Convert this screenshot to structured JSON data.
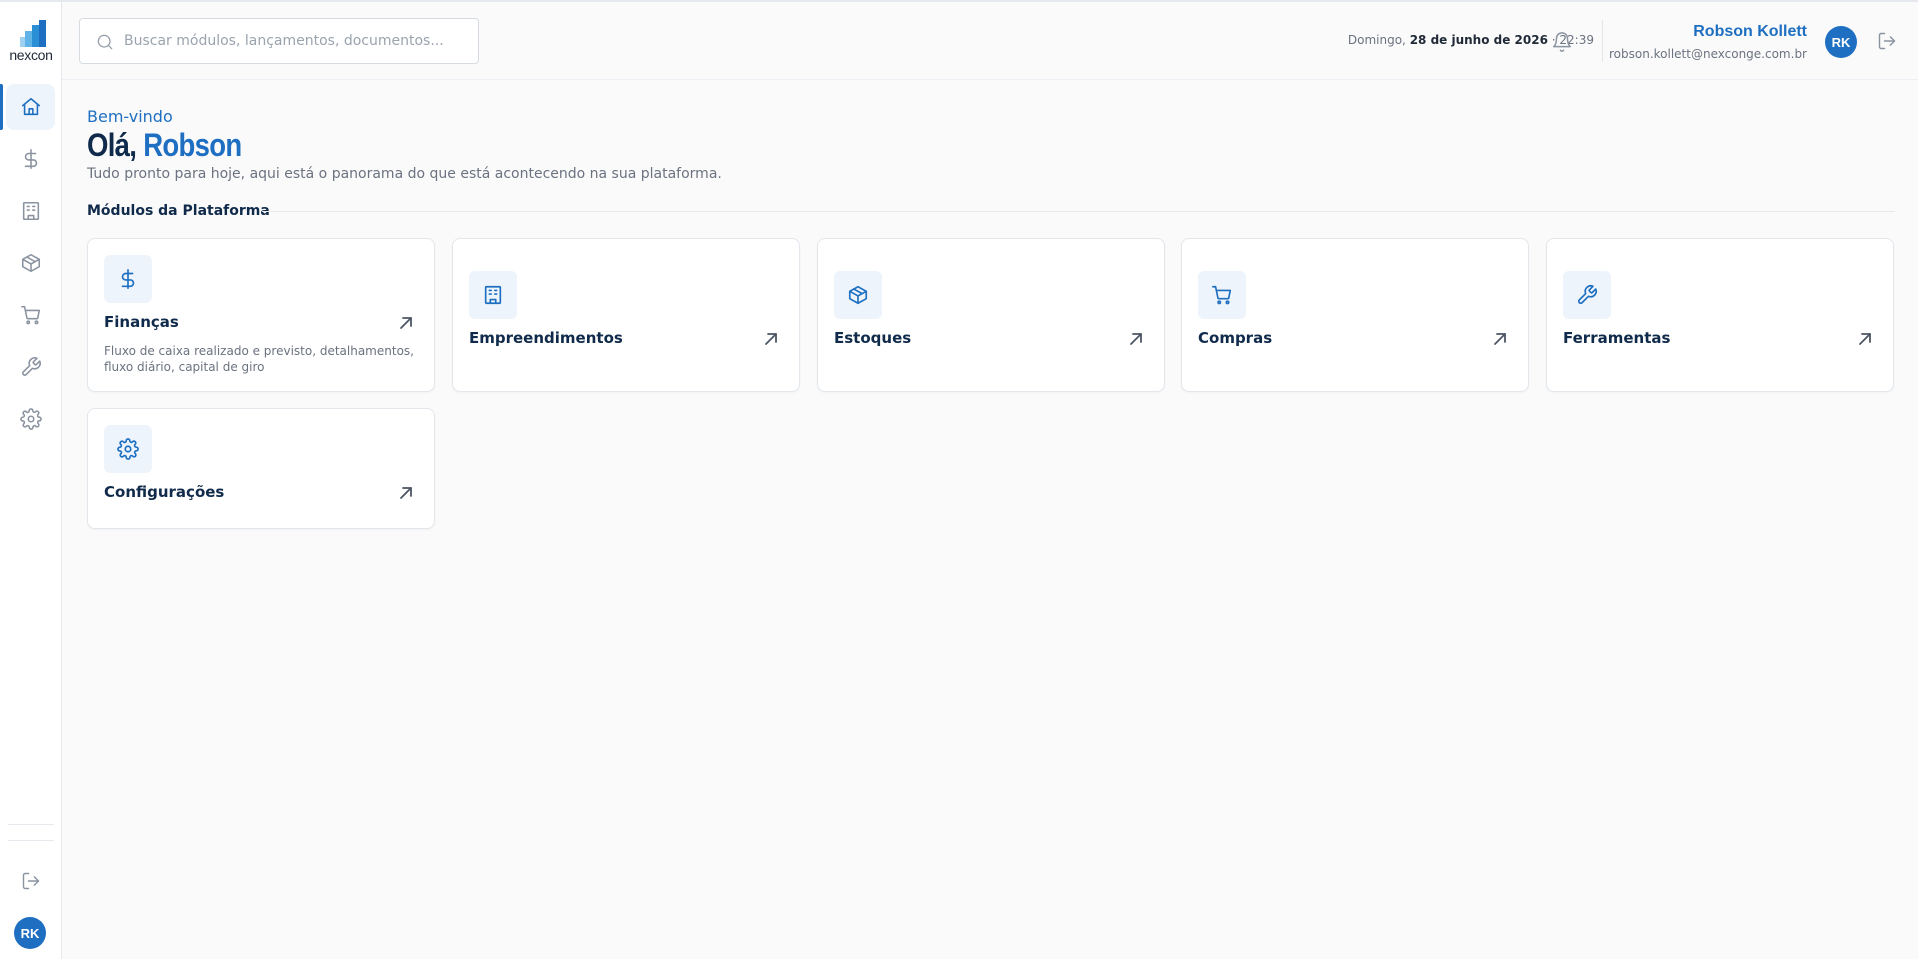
{
  "brand": {
    "name": "nexcon",
    "accent": "#1e6fc1",
    "navy": "#0f2a4a"
  },
  "sidebar": {
    "items": [
      {
        "name": "home",
        "icon": "home-icon",
        "active": true
      },
      {
        "name": "financas",
        "icon": "dollar-icon",
        "active": false
      },
      {
        "name": "empreendimentos",
        "icon": "building-icon",
        "active": false
      },
      {
        "name": "estoques",
        "icon": "box-icon",
        "active": false
      },
      {
        "name": "compras",
        "icon": "cart-icon",
        "active": false
      },
      {
        "name": "ferramentas",
        "icon": "wrench-icon",
        "active": false
      },
      {
        "name": "configuracoes",
        "icon": "gear-icon",
        "active": false
      }
    ],
    "avatar_initials": "RK"
  },
  "header": {
    "search_placeholder": "Buscar módulos, lançamentos, documentos...",
    "date_weekday": "Domingo,",
    "date_full": "28 de junho de 2026",
    "time": "· 22:39",
    "user_name": "Robson Kollett",
    "user_email": "robson.kollett@nexconge.com.br",
    "avatar_initials": "RK"
  },
  "main": {
    "welcome": "Bem-vindo",
    "greeting": "Olá,",
    "greeting_name": "Robson",
    "subtitle": "Tudo pronto para hoje, aqui está o panorama do que está acontecendo na sua plataforma.",
    "section_title": "Módulos da Plataforma",
    "modules": [
      {
        "title": "Finanças",
        "icon": "dollar-icon",
        "description": "Fluxo de caixa realizado e previsto, detalhamentos, fluxo diário, capital de giro"
      },
      {
        "title": "Empreendimentos",
        "icon": "building-icon"
      },
      {
        "title": "Estoques",
        "icon": "box-icon"
      },
      {
        "title": "Compras",
        "icon": "cart-icon"
      },
      {
        "title": "Ferramentas",
        "icon": "wrench-icon"
      },
      {
        "title": "Configurações",
        "icon": "gear-icon"
      }
    ]
  }
}
